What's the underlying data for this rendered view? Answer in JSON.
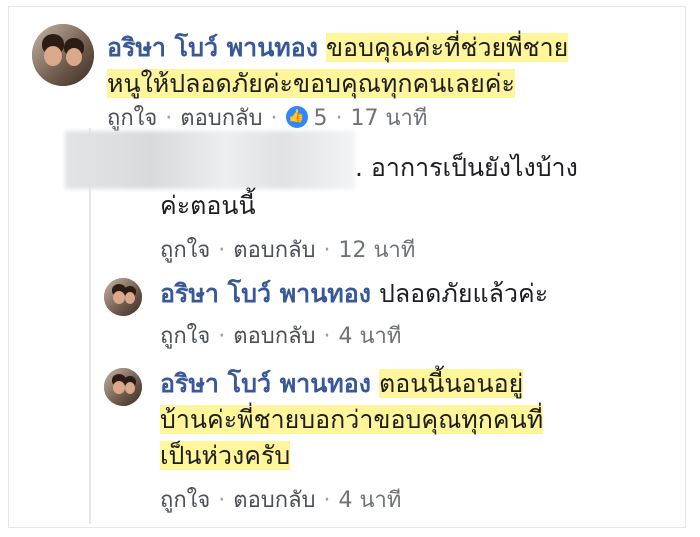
{
  "comment1": {
    "author": "อริษา โบว์ พานทอง",
    "text_line1": "ขอบคุณค่ะที่ช่วยพี่ชาย",
    "text_line2": "หนูให้ปลอดภัยค่ะขอบคุณทุกคนเลยค่ะ",
    "like_label": "ถูกใจ",
    "reply_label": "ตอบกลับ",
    "reactions": "5",
    "time": "17 นาที"
  },
  "reply1": {
    "text_line1": ". อาการเป็นยังไงบ้าง",
    "text_line2": "ค่ะตอนนี้",
    "like_label": "ถูกใจ",
    "reply_label": "ตอบกลับ",
    "time": "12 นาที"
  },
  "reply2": {
    "author": "อริษา โบว์ พานทอง",
    "text": "ปลอดภัยแล้วค่ะ",
    "like_label": "ถูกใจ",
    "reply_label": "ตอบกลับ",
    "time": "4 นาที"
  },
  "reply3": {
    "author": "อริษา โบว์ พานทอง",
    "text_line1": "ตอนนี้นอนอยู่",
    "text_line2": "บ้านค่ะพี่ชายบอกว่าขอบคุณทุกคนที่",
    "text_line3": "เป็นห่วงครับ",
    "like_label": "ถูกใจ",
    "reply_label": "ตอบกลับ",
    "time": "4 นาที"
  },
  "separator": "·",
  "colors": {
    "author": "#385898",
    "highlight": "#fff59a",
    "reaction": "#2d88ff"
  },
  "icons": {
    "reaction": "thumbs-up-icon"
  }
}
